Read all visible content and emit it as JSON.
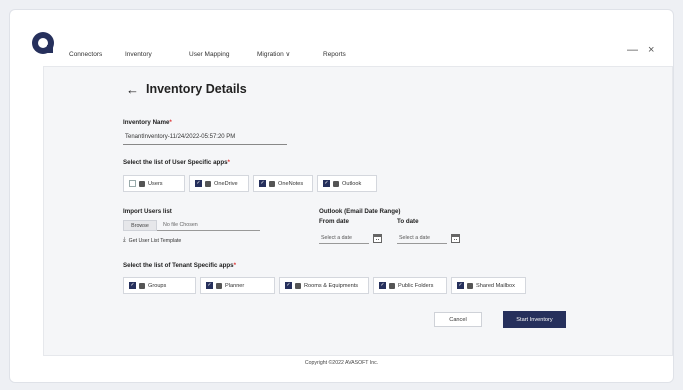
{
  "nav": {
    "items": [
      {
        "label": "Connectors",
        "active": false
      },
      {
        "label": "Inventory",
        "active": true
      },
      {
        "label": "User Mapping",
        "active": false
      },
      {
        "label": "Migration ∨",
        "active": false
      },
      {
        "label": "Reports",
        "active": false
      }
    ]
  },
  "window": {
    "minimize": "—",
    "close": "×"
  },
  "page": {
    "back": "←",
    "title": "Inventory Details"
  },
  "inventory_name": {
    "label": "Inventory Name",
    "required_mark": "*",
    "value": "TenantInventory-11/24/2022-05:57:20 PM"
  },
  "user_apps": {
    "label": "Select the list of User Specific apps",
    "required_mark": "*",
    "items": [
      {
        "label": "Users",
        "checked": false,
        "icon": "users-icon"
      },
      {
        "label": "OneDrive",
        "checked": true,
        "icon": "onedrive-icon"
      },
      {
        "label": "OneNotes",
        "checked": true,
        "icon": "onenote-icon"
      },
      {
        "label": "Outlook",
        "checked": true,
        "icon": "outlook-icon"
      }
    ]
  },
  "import_users": {
    "label": "Import Users list",
    "browse": "Browse",
    "file_placeholder": "No file Chosen",
    "template_link": "Get User List Template"
  },
  "outlook_range": {
    "label": "Outlook (Email Date Range)",
    "from_label": "From date",
    "to_label": "To date",
    "from_placeholder": "Select a date",
    "to_placeholder": "Select a date"
  },
  "tenant_apps": {
    "label": "Select the list of Tenant Specific apps",
    "required_mark": "*",
    "items": [
      {
        "label": "Groups",
        "checked": true,
        "icon": "groups-icon"
      },
      {
        "label": "Planner",
        "checked": true,
        "icon": "planner-icon"
      },
      {
        "label": "Rooms & Equipments",
        "checked": true,
        "icon": "rooms-icon"
      },
      {
        "label": "Public Folders",
        "checked": true,
        "icon": "folder-icon"
      },
      {
        "label": "Shared Mailbox",
        "checked": true,
        "icon": "mailbox-icon"
      }
    ]
  },
  "actions": {
    "cancel": "Cancel",
    "start": "Start Inventory"
  },
  "footer": {
    "copyright": "Copyright ©2022 AVASOFT Inc."
  },
  "colors": {
    "accent": "#26305c",
    "background": "#f5f6f8"
  }
}
